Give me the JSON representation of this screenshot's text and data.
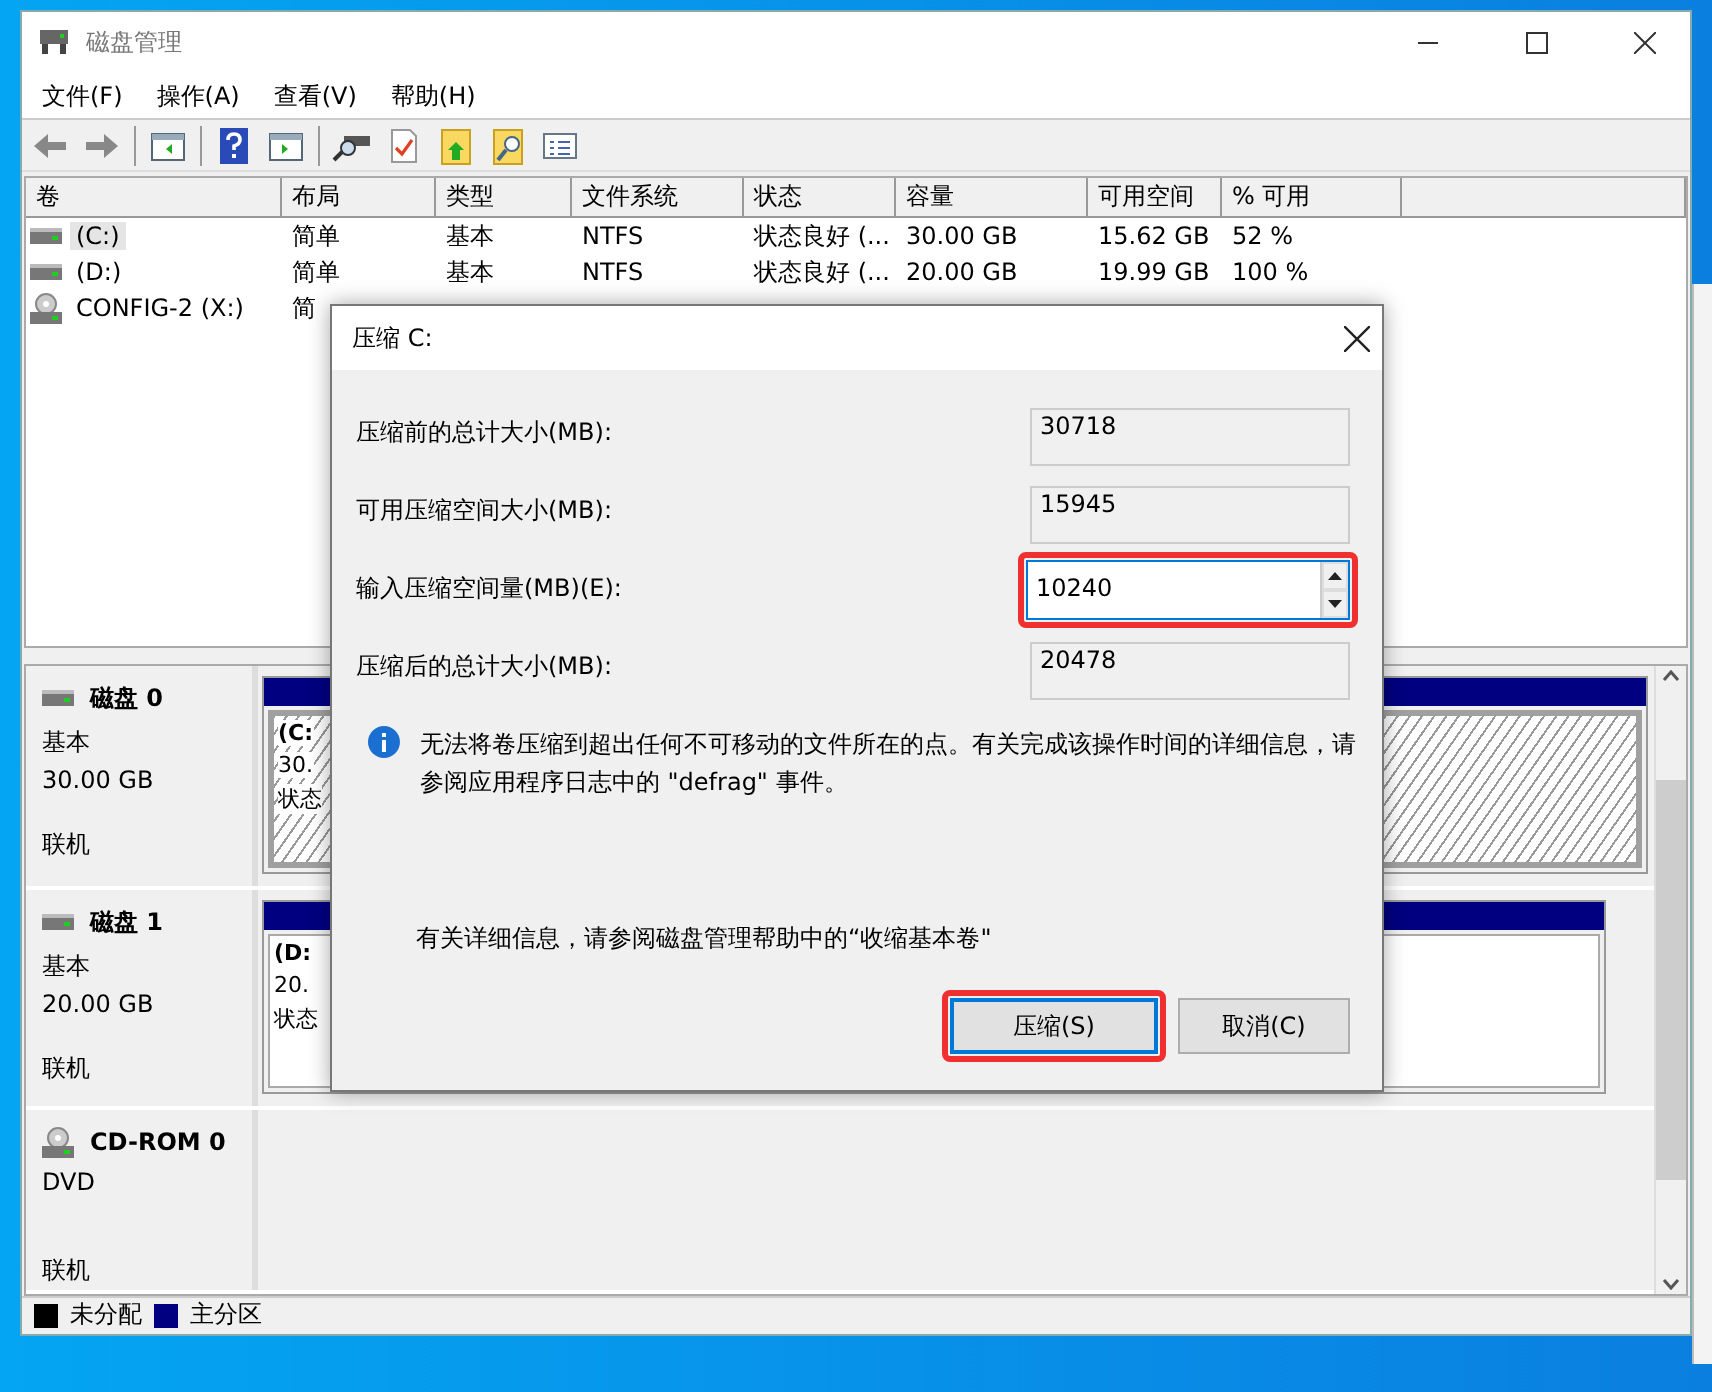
{
  "window": {
    "title": "磁盘管理"
  },
  "menu": [
    "文件(F)",
    "操作(A)",
    "查看(V)",
    "帮助(H)"
  ],
  "volume_list": {
    "columns": [
      "卷",
      "布局",
      "类型",
      "文件系统",
      "状态",
      "容量",
      "可用空间",
      "% 可用"
    ],
    "rows": [
      {
        "kind": "disk",
        "selected": true,
        "cells": [
          "(C:)",
          "简单",
          "基本",
          "NTFS",
          "状态良好 (...",
          "30.00 GB",
          "15.62 GB",
          "52 %"
        ]
      },
      {
        "kind": "disk",
        "selected": false,
        "cells": [
          "(D:)",
          "简单",
          "基本",
          "NTFS",
          "状态良好 (...",
          "20.00 GB",
          "19.99 GB",
          "100 %"
        ]
      },
      {
        "kind": "cdrom",
        "selected": false,
        "cells": [
          "CONFIG-2 (X:)",
          "简"
        ]
      }
    ]
  },
  "disks": [
    {
      "name": "磁盘 0",
      "kind": "disk",
      "lines": [
        "基本",
        "30.00 GB",
        "联机"
      ],
      "partitions": [
        {
          "label": "(C:",
          "lines": [
            "30.",
            "状态"
          ],
          "selected": true
        }
      ]
    },
    {
      "name": "磁盘 1",
      "kind": "disk",
      "lines": [
        "基本",
        "20.00 GB",
        "联机"
      ],
      "partitions": [
        {
          "label": "(D:",
          "lines": [
            "20.",
            "状态"
          ],
          "selected": false
        }
      ]
    },
    {
      "name": "CD-ROM 0",
      "kind": "cdrom",
      "lines": [
        "DVD",
        "联机"
      ]
    }
  ],
  "legend": [
    {
      "label": "未分配",
      "color": "#000000"
    },
    {
      "label": "主分区",
      "color": "#000080"
    }
  ],
  "dialog": {
    "title": "压缩 C:",
    "fields": [
      {
        "label": "压缩前的总计大小(MB):",
        "value": "30718",
        "kind": "readonly",
        "highlighted": false
      },
      {
        "label": "可用压缩空间大小(MB):",
        "value": "15945",
        "kind": "readonly",
        "highlighted": false
      },
      {
        "label": "输入压缩空间量(MB)(E):",
        "value": "10240",
        "kind": "spin",
        "highlighted": true
      },
      {
        "label": "压缩后的总计大小(MB):",
        "value": "20478",
        "kind": "readonly",
        "highlighted": false
      }
    ],
    "info": "无法将卷压缩到超出任何不可移动的文件所在的点。有关完成该操作时间的详细信息，请参阅应用程序日志中的 \"defrag\" 事件。",
    "help": "有关详细信息，请参阅磁盘管理帮助中的“收缩基本卷\"",
    "buttons": [
      {
        "label": "压缩(S)",
        "default": true,
        "highlighted": true
      },
      {
        "label": "取消(C)",
        "default": false,
        "highlighted": false
      }
    ]
  }
}
